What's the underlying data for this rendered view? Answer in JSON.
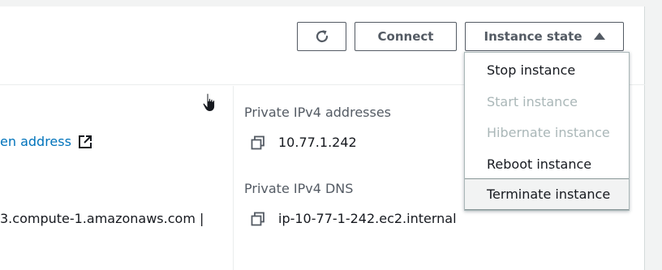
{
  "header": {
    "refresh_icon": "refresh-icon",
    "connect_label": "Connect",
    "instance_state_label": "Instance state",
    "instance_state_caret_icon": "caret-up-icon"
  },
  "instance_state_menu": {
    "items": [
      {
        "label": "Stop instance",
        "enabled": true
      },
      {
        "label": "Start instance",
        "enabled": false
      },
      {
        "label": "Hibernate instance",
        "enabled": false
      },
      {
        "label": "Reboot instance",
        "enabled": true
      },
      {
        "label": "Terminate instance",
        "enabled": true,
        "hovered": true
      }
    ]
  },
  "details": {
    "left": {
      "open_address_link": "en address",
      "open_address_icon": "external-link-icon",
      "public_dns_value": "3.compute-1.amazonaws.com |"
    },
    "right": {
      "private_ipv4_label": "Private IPv4 addresses",
      "private_ipv4_value": "10.77.1.242",
      "private_dns_label": "Private IPv4 DNS",
      "private_dns_value": "ip-10-77-1-242.ec2.internal",
      "copy_icon": "copy-icon"
    }
  },
  "colors": {
    "link": "#0073bb",
    "text": "#16191f",
    "label": "#545b64",
    "disabled": "#aab7b8",
    "background": "#f2f3f3"
  }
}
